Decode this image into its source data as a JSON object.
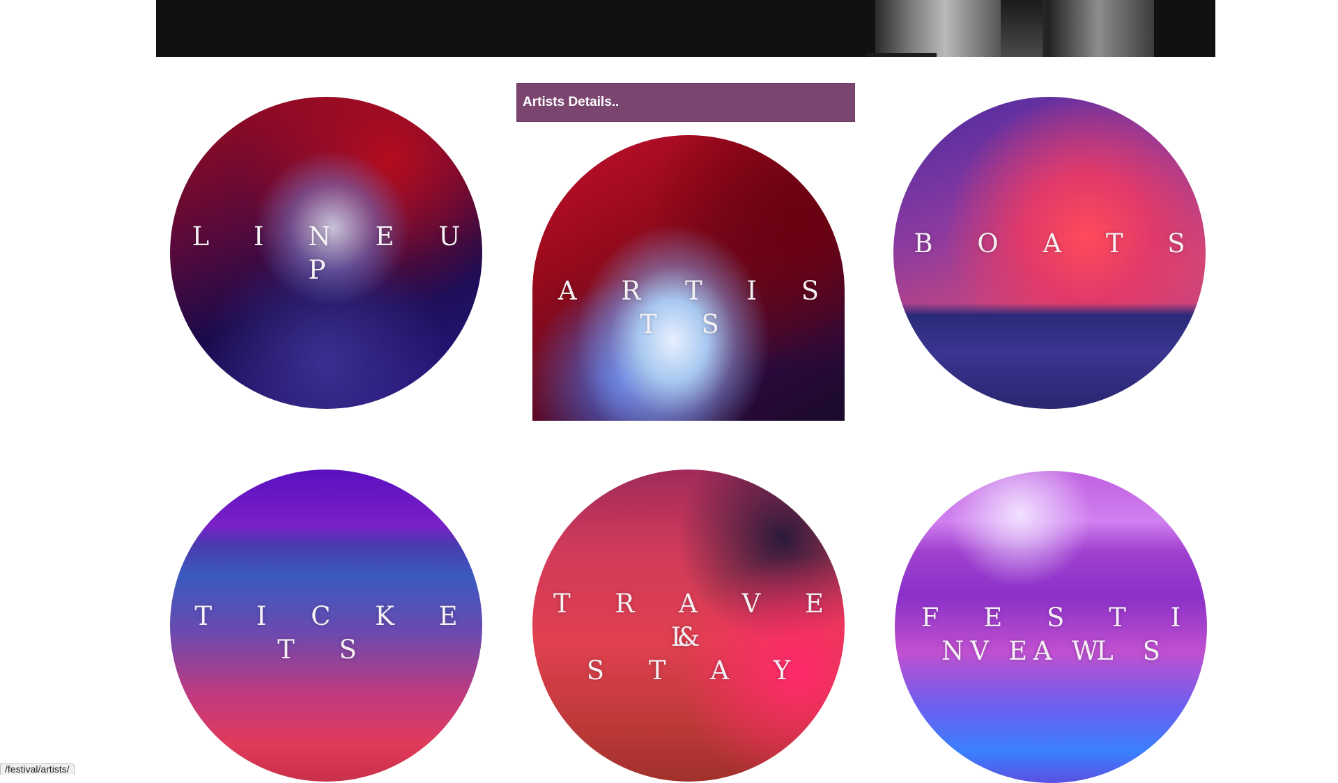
{
  "banner": {
    "image": "black-and-white portrait photo"
  },
  "tooltip": {
    "text": "Artists Details.."
  },
  "tiles": {
    "lineup": {
      "label": "L I N E  U P"
    },
    "artists": {
      "label": "A R T I S T S"
    },
    "boats": {
      "label": "B O A T S"
    },
    "tickets": {
      "label": "T I C K E T S"
    },
    "travel": {
      "line1": "T R A V E L",
      "line2": "&",
      "line3": "S T A Y"
    },
    "news": {
      "line1": "F E S T I V A L",
      "line2": "N E W S"
    }
  },
  "status_bar": {
    "url": "/festival/artists/"
  }
}
